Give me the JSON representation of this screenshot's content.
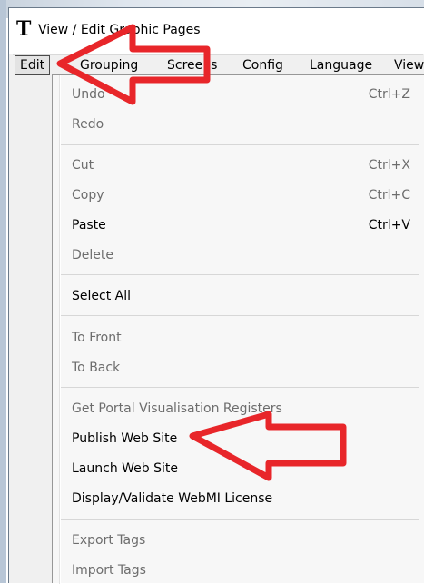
{
  "window": {
    "app_icon": "T",
    "title": "View / Edit Graphic Pages"
  },
  "menubar": {
    "items": [
      "Edit",
      "Grouping",
      "Screens",
      "Config",
      "Language",
      "View"
    ]
  },
  "edit_menu": {
    "undo": {
      "label": "Undo",
      "shortcut": "Ctrl+Z"
    },
    "redo": {
      "label": "Redo"
    },
    "cut": {
      "label": "Cut",
      "shortcut": "Ctrl+X"
    },
    "copy": {
      "label": "Copy",
      "shortcut": "Ctrl+C"
    },
    "paste": {
      "label": "Paste",
      "shortcut": "Ctrl+V"
    },
    "delete": {
      "label": "Delete"
    },
    "select_all": {
      "label": "Select All"
    },
    "to_front": {
      "label": "To Front"
    },
    "to_back": {
      "label": "To Back"
    },
    "get_portal": {
      "label": "Get Portal Visualisation Registers"
    },
    "publish": {
      "label": "Publish Web Site"
    },
    "launch": {
      "label": "Launch Web Site"
    },
    "display_license": {
      "label": "Display/Validate WebMI License"
    },
    "export_tags": {
      "label": "Export Tags"
    },
    "import_tags": {
      "label": "Import Tags"
    }
  },
  "annotation_color": "#e8262a"
}
